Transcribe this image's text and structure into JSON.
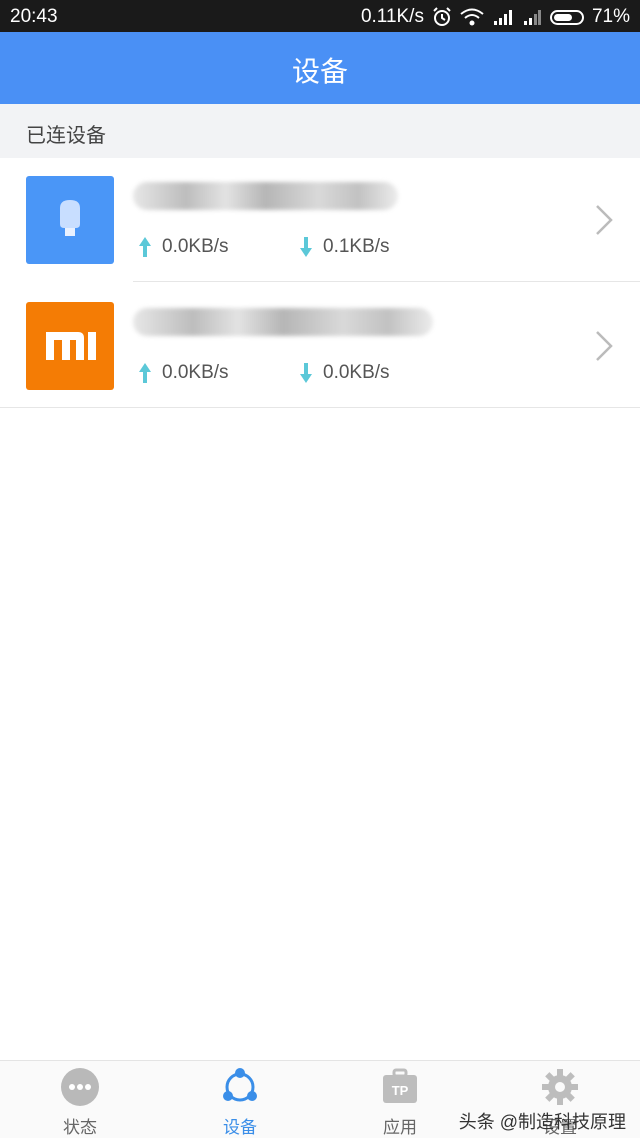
{
  "status_bar": {
    "time": "20:43",
    "net_speed": "0.11K/s",
    "battery": "71%",
    "battery_level": 0.71
  },
  "header": {
    "title": "设备"
  },
  "section": {
    "title": "已连设备"
  },
  "devices": [
    {
      "upload": "0.0KB/s",
      "download": "0.1KB/s",
      "icon": "bulb-icon",
      "color": "#4a96f7"
    },
    {
      "upload": "0.0KB/s",
      "download": "0.0KB/s",
      "icon": "mi-logo",
      "color": "#f47c05"
    }
  ],
  "tabs": [
    {
      "label": "状态",
      "icon": "status-dots-icon",
      "active": false
    },
    {
      "label": "设备",
      "icon": "devices-icon",
      "active": true
    },
    {
      "label": "应用",
      "icon": "tp-app-icon",
      "active": false
    },
    {
      "label": "设置",
      "icon": "gear-icon",
      "active": false
    }
  ],
  "watermark": "头条 @制造科技原理",
  "colors": {
    "header": "#4a90f5",
    "active_tab": "#3a8ee8",
    "arrow": "#5bc8d8"
  }
}
